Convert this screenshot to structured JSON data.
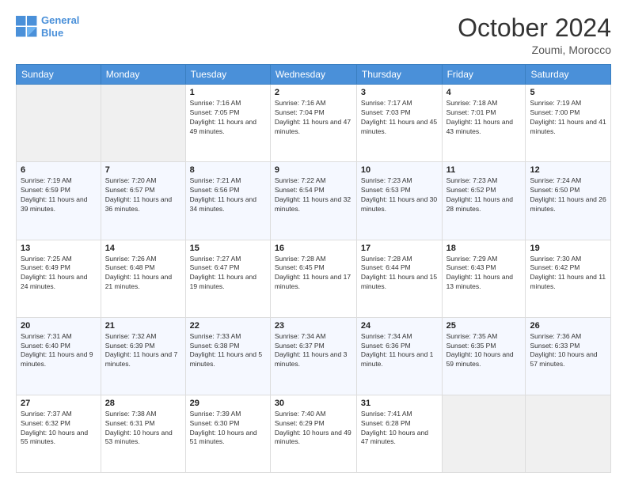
{
  "logo": {
    "line1": "General",
    "line2": "Blue"
  },
  "title": "October 2024",
  "location": "Zoumi, Morocco",
  "days_header": [
    "Sunday",
    "Monday",
    "Tuesday",
    "Wednesday",
    "Thursday",
    "Friday",
    "Saturday"
  ],
  "weeks": [
    [
      {
        "day": "",
        "info": ""
      },
      {
        "day": "",
        "info": ""
      },
      {
        "day": "1",
        "info": "Sunrise: 7:16 AM\nSunset: 7:05 PM\nDaylight: 11 hours and 49 minutes."
      },
      {
        "day": "2",
        "info": "Sunrise: 7:16 AM\nSunset: 7:04 PM\nDaylight: 11 hours and 47 minutes."
      },
      {
        "day": "3",
        "info": "Sunrise: 7:17 AM\nSunset: 7:03 PM\nDaylight: 11 hours and 45 minutes."
      },
      {
        "day": "4",
        "info": "Sunrise: 7:18 AM\nSunset: 7:01 PM\nDaylight: 11 hours and 43 minutes."
      },
      {
        "day": "5",
        "info": "Sunrise: 7:19 AM\nSunset: 7:00 PM\nDaylight: 11 hours and 41 minutes."
      }
    ],
    [
      {
        "day": "6",
        "info": "Sunrise: 7:19 AM\nSunset: 6:59 PM\nDaylight: 11 hours and 39 minutes."
      },
      {
        "day": "7",
        "info": "Sunrise: 7:20 AM\nSunset: 6:57 PM\nDaylight: 11 hours and 36 minutes."
      },
      {
        "day": "8",
        "info": "Sunrise: 7:21 AM\nSunset: 6:56 PM\nDaylight: 11 hours and 34 minutes."
      },
      {
        "day": "9",
        "info": "Sunrise: 7:22 AM\nSunset: 6:54 PM\nDaylight: 11 hours and 32 minutes."
      },
      {
        "day": "10",
        "info": "Sunrise: 7:23 AM\nSunset: 6:53 PM\nDaylight: 11 hours and 30 minutes."
      },
      {
        "day": "11",
        "info": "Sunrise: 7:23 AM\nSunset: 6:52 PM\nDaylight: 11 hours and 28 minutes."
      },
      {
        "day": "12",
        "info": "Sunrise: 7:24 AM\nSunset: 6:50 PM\nDaylight: 11 hours and 26 minutes."
      }
    ],
    [
      {
        "day": "13",
        "info": "Sunrise: 7:25 AM\nSunset: 6:49 PM\nDaylight: 11 hours and 24 minutes."
      },
      {
        "day": "14",
        "info": "Sunrise: 7:26 AM\nSunset: 6:48 PM\nDaylight: 11 hours and 21 minutes."
      },
      {
        "day": "15",
        "info": "Sunrise: 7:27 AM\nSunset: 6:47 PM\nDaylight: 11 hours and 19 minutes."
      },
      {
        "day": "16",
        "info": "Sunrise: 7:28 AM\nSunset: 6:45 PM\nDaylight: 11 hours and 17 minutes."
      },
      {
        "day": "17",
        "info": "Sunrise: 7:28 AM\nSunset: 6:44 PM\nDaylight: 11 hours and 15 minutes."
      },
      {
        "day": "18",
        "info": "Sunrise: 7:29 AM\nSunset: 6:43 PM\nDaylight: 11 hours and 13 minutes."
      },
      {
        "day": "19",
        "info": "Sunrise: 7:30 AM\nSunset: 6:42 PM\nDaylight: 11 hours and 11 minutes."
      }
    ],
    [
      {
        "day": "20",
        "info": "Sunrise: 7:31 AM\nSunset: 6:40 PM\nDaylight: 11 hours and 9 minutes."
      },
      {
        "day": "21",
        "info": "Sunrise: 7:32 AM\nSunset: 6:39 PM\nDaylight: 11 hours and 7 minutes."
      },
      {
        "day": "22",
        "info": "Sunrise: 7:33 AM\nSunset: 6:38 PM\nDaylight: 11 hours and 5 minutes."
      },
      {
        "day": "23",
        "info": "Sunrise: 7:34 AM\nSunset: 6:37 PM\nDaylight: 11 hours and 3 minutes."
      },
      {
        "day": "24",
        "info": "Sunrise: 7:34 AM\nSunset: 6:36 PM\nDaylight: 11 hours and 1 minute."
      },
      {
        "day": "25",
        "info": "Sunrise: 7:35 AM\nSunset: 6:35 PM\nDaylight: 10 hours and 59 minutes."
      },
      {
        "day": "26",
        "info": "Sunrise: 7:36 AM\nSunset: 6:33 PM\nDaylight: 10 hours and 57 minutes."
      }
    ],
    [
      {
        "day": "27",
        "info": "Sunrise: 7:37 AM\nSunset: 6:32 PM\nDaylight: 10 hours and 55 minutes."
      },
      {
        "day": "28",
        "info": "Sunrise: 7:38 AM\nSunset: 6:31 PM\nDaylight: 10 hours and 53 minutes."
      },
      {
        "day": "29",
        "info": "Sunrise: 7:39 AM\nSunset: 6:30 PM\nDaylight: 10 hours and 51 minutes."
      },
      {
        "day": "30",
        "info": "Sunrise: 7:40 AM\nSunset: 6:29 PM\nDaylight: 10 hours and 49 minutes."
      },
      {
        "day": "31",
        "info": "Sunrise: 7:41 AM\nSunset: 6:28 PM\nDaylight: 10 hours and 47 minutes."
      },
      {
        "day": "",
        "info": ""
      },
      {
        "day": "",
        "info": ""
      }
    ]
  ]
}
